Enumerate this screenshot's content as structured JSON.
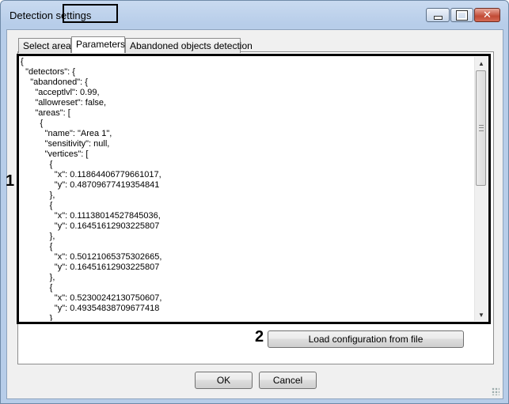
{
  "window": {
    "title": "Detection settings",
    "minimize_glyph": "",
    "close_glyph": "✕"
  },
  "tabs": [
    {
      "label": "Select area"
    },
    {
      "label": "Parameters"
    },
    {
      "label": "Abandoned objects detection"
    }
  ],
  "callouts": {
    "one": "1",
    "two": "2"
  },
  "editor": {
    "lines": [
      "{",
      "  \"detectors\": {",
      "    \"abandoned\": {",
      "      \"acceptlvl\": 0.99,",
      "      \"allowreset\": false,",
      "      \"areas\": [",
      "        {",
      "          \"name\": \"Area 1\",",
      "          \"sensitivity\": null,",
      "          \"vertices\": [",
      "            {",
      "              \"x\": 0.11864406779661017,",
      "              \"y\": 0.48709677419354841",
      "            },",
      "            {",
      "              \"x\": 0.11138014527845036,",
      "              \"y\": 0.16451612903225807",
      "            },",
      "            {",
      "              \"x\": 0.50121065375302665,",
      "              \"y\": 0.16451612903225807",
      "            },",
      "            {",
      "              \"x\": 0.52300242130750607,",
      "              \"y\": 0.49354838709677418",
      "            }"
    ]
  },
  "buttons": {
    "load": "Load configuration from file",
    "ok": "OK",
    "cancel": "Cancel"
  },
  "colors": {
    "title_bg": "#b7cde9",
    "client_bg": "#f0f0f0",
    "callout_border": "#000000"
  }
}
